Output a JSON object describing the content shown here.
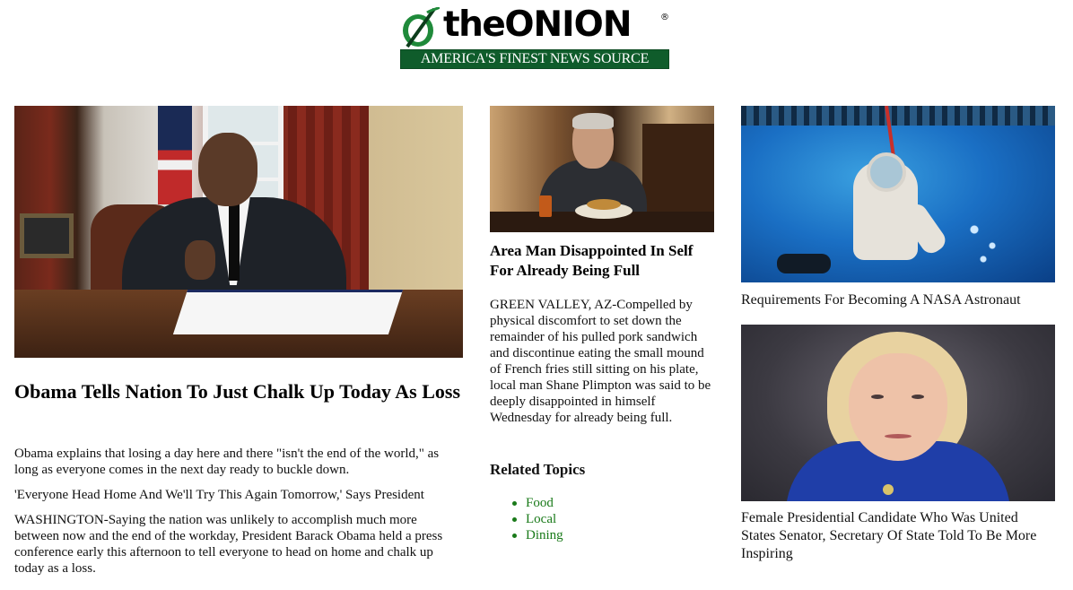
{
  "masthead": {
    "logo_the": "the",
    "logo_onion": "ONION",
    "registered": "®",
    "tagline": "AMERICA'S FINEST NEWS SOURCE",
    "brand_color": "#0f5c2b"
  },
  "lead": {
    "image_icon": "photo-icon",
    "headline": "Obama Tells Nation To Just Chalk Up Today As Loss",
    "dek": "Obama explains that losing a day here and there \"isn't the end of the world,\" as long as everyone comes in the next day ready to buckle down.",
    "subhead": "'Everyone Head Home And We'll Try This Again Tomorrow,' Says President",
    "body": "WASHINGTON-Saying the nation was unlikely to accomplish much more between now and the end of the workday, President Barack Obama held a press conference early this afternoon to tell everyone to head on home and chalk up today as a loss."
  },
  "middle": {
    "headline": "Area Man Disappointed In Self For Already Being Full",
    "body": "GREEN VALLEY, AZ-Compelled by physical discomfort to set down the remainder of his pulled pork sandwich and discontinue eating the small mound of French fries still sitting on his plate, local man Shane Plimpton was said to be deeply disappointed in himself Wednesday for already being full.",
    "related_title": "Related Topics",
    "related": [
      "Food",
      "Local",
      "Dining"
    ],
    "link_color": "#1a7a1a"
  },
  "right": {
    "story1_caption": "Requirements For Becoming A NASA Astronaut",
    "story2_caption": "Female Presidential Candidate Who Was United States Senator, Secretary Of State Told To Be More Inspiring"
  }
}
